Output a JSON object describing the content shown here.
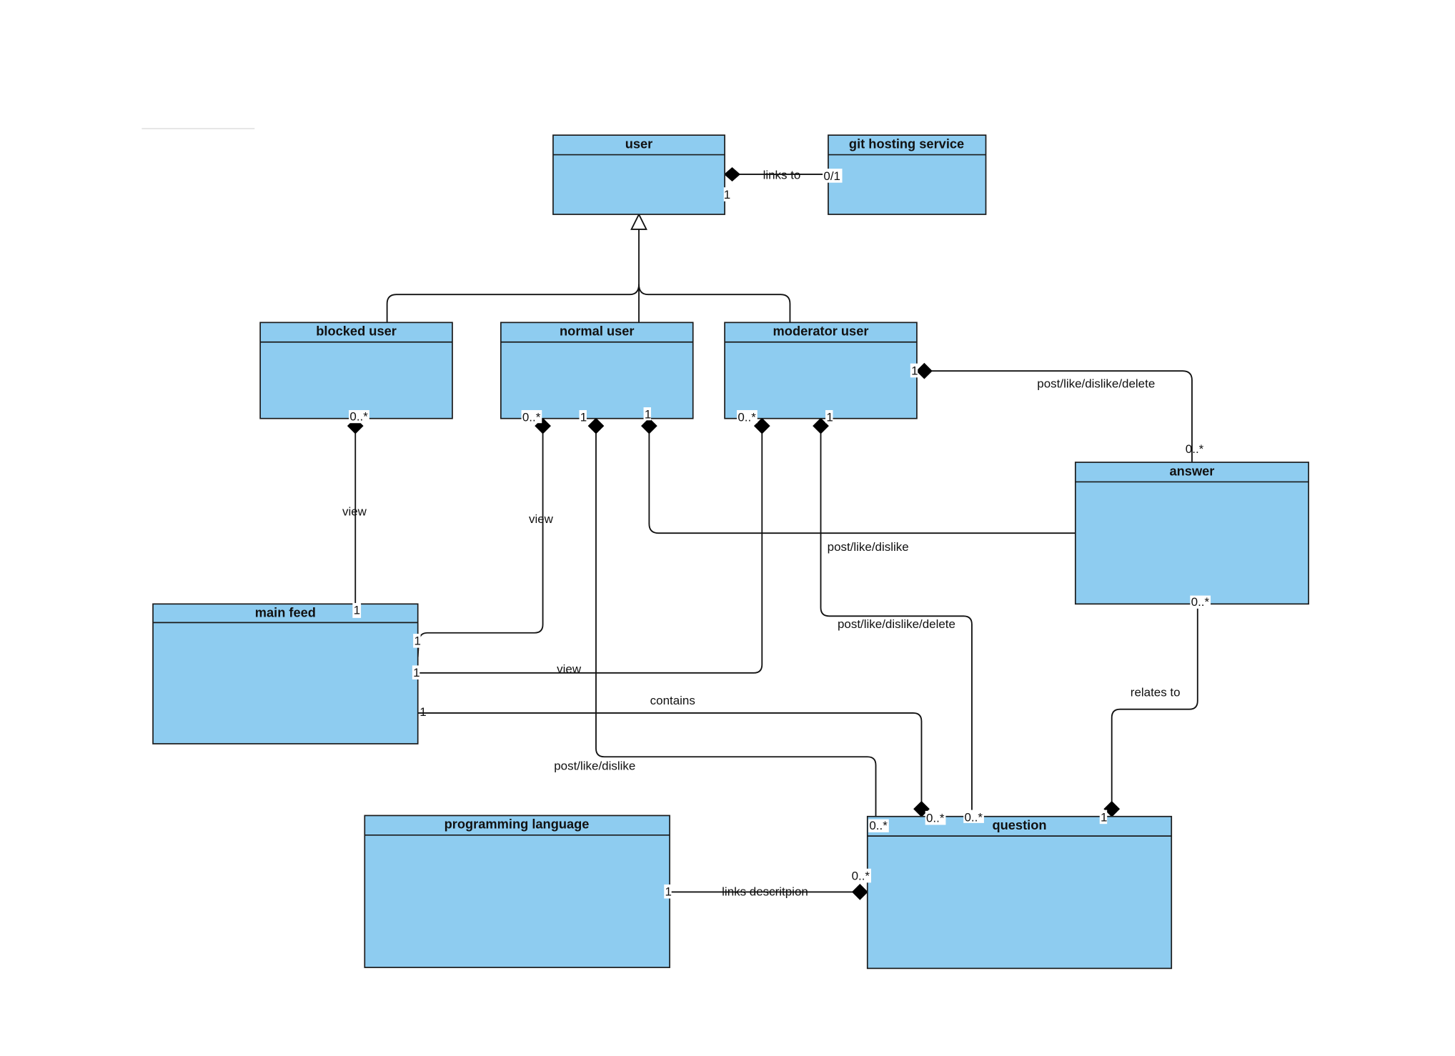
{
  "diagram": {
    "type": "UML class diagram",
    "colors": {
      "class_fill": "#8ECCF0",
      "class_border": "#1a1a1a",
      "edge": "#111111",
      "background": "#ffffff"
    },
    "classes": [
      {
        "id": "user",
        "name": "user"
      },
      {
        "id": "git",
        "name": "git hosting service"
      },
      {
        "id": "blocked",
        "name": "blocked user"
      },
      {
        "id": "normal",
        "name": "normal user"
      },
      {
        "id": "moderator",
        "name": "moderator user"
      },
      {
        "id": "answer",
        "name": "answer"
      },
      {
        "id": "feed",
        "name": "main feed"
      },
      {
        "id": "lang",
        "name": "programming language"
      },
      {
        "id": "question",
        "name": "question"
      }
    ],
    "relations": [
      {
        "id": "r-links-to",
        "kind": "composition",
        "from": "user",
        "to": "git",
        "label": "links to",
        "from_mult": "1",
        "to_mult": "0/1"
      },
      {
        "id": "r-gen-blocked",
        "kind": "generalization",
        "from": "blocked",
        "to": "user",
        "label": ""
      },
      {
        "id": "r-gen-normal",
        "kind": "generalization",
        "from": "normal",
        "to": "user",
        "label": ""
      },
      {
        "id": "r-gen-moderator",
        "kind": "generalization",
        "from": "moderator",
        "to": "user",
        "label": ""
      },
      {
        "id": "r-blocked-view",
        "kind": "composition",
        "from": "blocked",
        "to": "feed",
        "label": "view",
        "from_mult": "0..*",
        "to_mult": "1"
      },
      {
        "id": "r-normal-view",
        "kind": "composition",
        "from": "normal",
        "to": "feed",
        "label": "view",
        "from_mult": "0..*",
        "to_mult": "1"
      },
      {
        "id": "r-normal-question",
        "kind": "composition",
        "from": "normal",
        "to": "question",
        "label": "post/like/dislike",
        "from_mult": "1",
        "to_mult": "0..*"
      },
      {
        "id": "r-normal-answer",
        "kind": "composition",
        "from": "normal",
        "to": "answer",
        "label": "post/like/dislike",
        "from_mult": "1",
        "to_mult": ""
      },
      {
        "id": "r-moderator-view",
        "kind": "composition",
        "from": "moderator",
        "to": "feed",
        "label": "view",
        "from_mult": "0..*",
        "to_mult": "1"
      },
      {
        "id": "r-moderator-question",
        "kind": "composition",
        "from": "moderator",
        "to": "question",
        "label": "post/like/dislike/delete",
        "from_mult": "1",
        "to_mult": "0..*"
      },
      {
        "id": "r-moderator-answer",
        "kind": "composition",
        "from": "moderator",
        "to": "answer",
        "label": "post/like/dislike/delete",
        "from_mult": "1",
        "to_mult": "0..*"
      },
      {
        "id": "r-feed-contains",
        "kind": "composition",
        "from": "question",
        "to": "feed",
        "label": "contains",
        "from_mult": "0..*",
        "to_mult": "1"
      },
      {
        "id": "r-answer-relates",
        "kind": "composition",
        "from": "question",
        "to": "answer",
        "label": "relates to",
        "from_mult": "1",
        "to_mult": "0..*"
      },
      {
        "id": "r-lang-links",
        "kind": "composition",
        "from": "question",
        "to": "lang",
        "label": "links descritpion",
        "from_mult": "0..*",
        "to_mult": "1"
      }
    ],
    "multiplicities": {
      "user_git_user": "1",
      "user_git_git": "0/1",
      "blocked_bottom": "0..*",
      "normal_bottom_left": "0..*",
      "normal_bottom_mid": "1",
      "normal_bottom_right": "1",
      "moderator_bottom_left": "0..*",
      "moderator_bottom_right": "1",
      "moderator_right": "1",
      "answer_top": "0..*",
      "answer_bottom": "0..*",
      "feed_top": "1",
      "feed_right_1": "1",
      "feed_right_2": "1",
      "feed_right_3": "1",
      "question_top_1": "0..*",
      "question_top_2": "0..*",
      "question_top_3": "0..*",
      "question_top_4": "1",
      "question_left": "0..*",
      "lang_right": "1"
    }
  }
}
